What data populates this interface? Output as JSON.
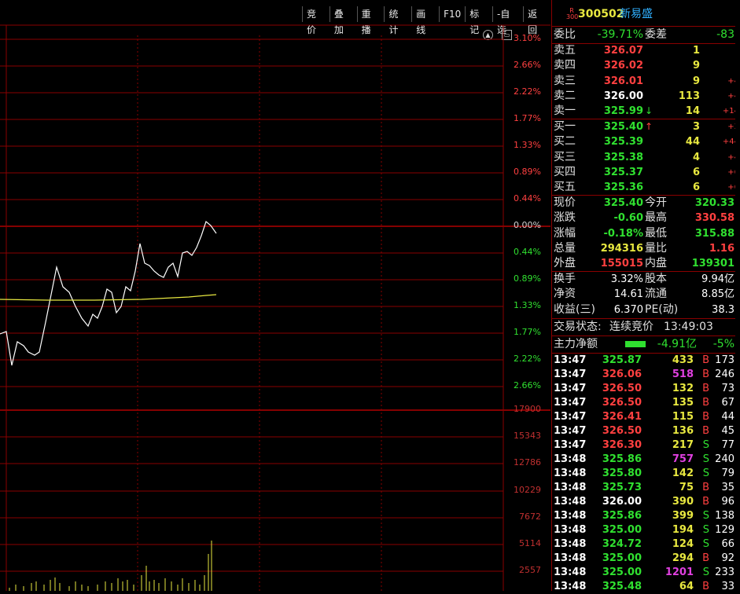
{
  "toolbar": [
    "竞价",
    "叠加",
    "重播",
    "统计",
    "画线",
    "F10",
    "标记",
    "-自选",
    "返回"
  ],
  "stock": {
    "badge_r": "R",
    "badge_num": "300",
    "code": "300502",
    "name": "新易盛"
  },
  "chart": {
    "pct_labels": [
      {
        "text": "3.10%",
        "color": "#ff4040"
      },
      {
        "text": "2.66%",
        "color": "#ff4040"
      },
      {
        "text": "2.22%",
        "color": "#ff4040"
      },
      {
        "text": "1.77%",
        "color": "#ff4040"
      },
      {
        "text": "1.33%",
        "color": "#ff4040"
      },
      {
        "text": "0.89%",
        "color": "#ff4040"
      },
      {
        "text": "0.44%",
        "color": "#ff4040"
      },
      {
        "text": "0.00%",
        "color": "#d0d0d0"
      },
      {
        "text": "0.44%",
        "color": "#30e030"
      },
      {
        "text": "0.89%",
        "color": "#30e030"
      },
      {
        "text": "1.33%",
        "color": "#30e030"
      },
      {
        "text": "1.77%",
        "color": "#30e030"
      },
      {
        "text": "2.22%",
        "color": "#30e030"
      },
      {
        "text": "2.66%",
        "color": "#30e030"
      }
    ],
    "vol_labels": [
      "17900",
      "15343",
      "12786",
      "10229",
      "7672",
      "5114",
      "2557"
    ]
  },
  "weibi": {
    "label": "委比",
    "value": "-39.71%",
    "label2": "委差",
    "value2": "-83"
  },
  "sells": [
    {
      "label": "卖五",
      "price": "326.07",
      "vol": "1",
      "chg": "",
      "pcolor": "red",
      "arrow": ""
    },
    {
      "label": "卖四",
      "price": "326.02",
      "vol": "9",
      "chg": "",
      "pcolor": "red",
      "arrow": ""
    },
    {
      "label": "卖三",
      "price": "326.01",
      "vol": "9",
      "chg": "+4",
      "pcolor": "red",
      "arrow": ""
    },
    {
      "label": "卖二",
      "price": "326.00",
      "vol": "113",
      "chg": "+4",
      "pcolor": "white",
      "arrow": ""
    },
    {
      "label": "卖一",
      "price": "325.99",
      "vol": "14",
      "chg": "+14",
      "pcolor": "green",
      "arrow": "↓"
    }
  ],
  "buys": [
    {
      "label": "买一",
      "price": "325.40",
      "vol": "3",
      "chg": "+3",
      "pcolor": "green",
      "arrow": "↑"
    },
    {
      "label": "买二",
      "price": "325.39",
      "vol": "44",
      "chg": "+44",
      "pcolor": "green",
      "arrow": ""
    },
    {
      "label": "买三",
      "price": "325.38",
      "vol": "4",
      "chg": "+4",
      "pcolor": "green",
      "arrow": ""
    },
    {
      "label": "买四",
      "price": "325.37",
      "vol": "6",
      "chg": "+6",
      "pcolor": "green",
      "arrow": ""
    },
    {
      "label": "买五",
      "price": "325.36",
      "vol": "6",
      "chg": "+6",
      "pcolor": "green",
      "arrow": ""
    }
  ],
  "quote": [
    {
      "l1": "现价",
      "v1": "325.40",
      "c1": "green",
      "l2": "今开",
      "v2": "320.33",
      "c2": "green"
    },
    {
      "l1": "涨跌",
      "v1": "-0.60",
      "c1": "green",
      "l2": "最高",
      "v2": "330.58",
      "c2": "red"
    },
    {
      "l1": "涨幅",
      "v1": "-0.18%",
      "c1": "green",
      "l2": "最低",
      "v2": "315.88",
      "c2": "green"
    },
    {
      "l1": "总量",
      "v1": "294316",
      "c1": "yellow",
      "l2": "量比",
      "v2": "1.16",
      "c2": "red"
    },
    {
      "l1": "外盘",
      "v1": "155015",
      "c1": "red",
      "l2": "内盘",
      "v2": "139301",
      "c2": "green"
    }
  ],
  "info": [
    {
      "l1": "换手",
      "v1": "3.32%",
      "l2": "股本",
      "v2": "9.94亿"
    },
    {
      "l1": "净资",
      "v1": "14.61",
      "l2": "流通",
      "v2": "8.85亿"
    },
    {
      "l1": "收益(三)",
      "v1": "6.370",
      "l2": "PE(动)",
      "v2": "38.3"
    }
  ],
  "status": {
    "label": "交易状态:",
    "value": "连续竞价",
    "time": "13:49:03"
  },
  "mainflow": {
    "label": "主力净额",
    "value": "-4.91亿",
    "pct": "-5%"
  },
  "ticks": [
    {
      "t": "13:47",
      "p": "325.87",
      "pc": "green",
      "v": "433",
      "vc": "yellow",
      "s": "B",
      "n": "173"
    },
    {
      "t": "13:47",
      "p": "326.06",
      "pc": "red",
      "v": "518",
      "vc": "purple",
      "s": "B",
      "n": "246"
    },
    {
      "t": "13:47",
      "p": "326.50",
      "pc": "red",
      "v": "132",
      "vc": "yellow",
      "s": "B",
      "n": "73"
    },
    {
      "t": "13:47",
      "p": "326.50",
      "pc": "red",
      "v": "135",
      "vc": "yellow",
      "s": "B",
      "n": "67"
    },
    {
      "t": "13:47",
      "p": "326.41",
      "pc": "red",
      "v": "115",
      "vc": "yellow",
      "s": "B",
      "n": "44"
    },
    {
      "t": "13:47",
      "p": "326.50",
      "pc": "red",
      "v": "136",
      "vc": "yellow",
      "s": "B",
      "n": "45"
    },
    {
      "t": "13:47",
      "p": "326.30",
      "pc": "red",
      "v": "217",
      "vc": "yellow",
      "s": "S",
      "n": "77"
    },
    {
      "t": "13:48",
      "p": "325.86",
      "pc": "green",
      "v": "757",
      "vc": "purple",
      "s": "S",
      "n": "240"
    },
    {
      "t": "13:48",
      "p": "325.80",
      "pc": "green",
      "v": "142",
      "vc": "yellow",
      "s": "S",
      "n": "79"
    },
    {
      "t": "13:48",
      "p": "325.73",
      "pc": "green",
      "v": "75",
      "vc": "yellow",
      "s": "B",
      "n": "35"
    },
    {
      "t": "13:48",
      "p": "326.00",
      "pc": "white",
      "v": "390",
      "vc": "yellow",
      "s": "B",
      "n": "96"
    },
    {
      "t": "13:48",
      "p": "325.86",
      "pc": "green",
      "v": "399",
      "vc": "yellow",
      "s": "S",
      "n": "138"
    },
    {
      "t": "13:48",
      "p": "325.00",
      "pc": "green",
      "v": "194",
      "vc": "yellow",
      "s": "S",
      "n": "129"
    },
    {
      "t": "13:48",
      "p": "324.72",
      "pc": "green",
      "v": "124",
      "vc": "yellow",
      "s": "S",
      "n": "66"
    },
    {
      "t": "13:48",
      "p": "325.00",
      "pc": "green",
      "v": "294",
      "vc": "yellow",
      "s": "B",
      "n": "92"
    },
    {
      "t": "13:48",
      "p": "325.00",
      "pc": "green",
      "v": "1201",
      "vc": "purple",
      "s": "S",
      "n": "233"
    },
    {
      "t": "13:48",
      "p": "325.48",
      "pc": "green",
      "v": "64",
      "vc": "yellow",
      "s": "B",
      "n": "33"
    }
  ],
  "colors": {
    "grid": "#8a0000",
    "price_line": "#ffffff",
    "avg_line": "#e8e840",
    "vol_bar": "#e8e840",
    "red": "#ff4040",
    "green": "#30e030"
  }
}
